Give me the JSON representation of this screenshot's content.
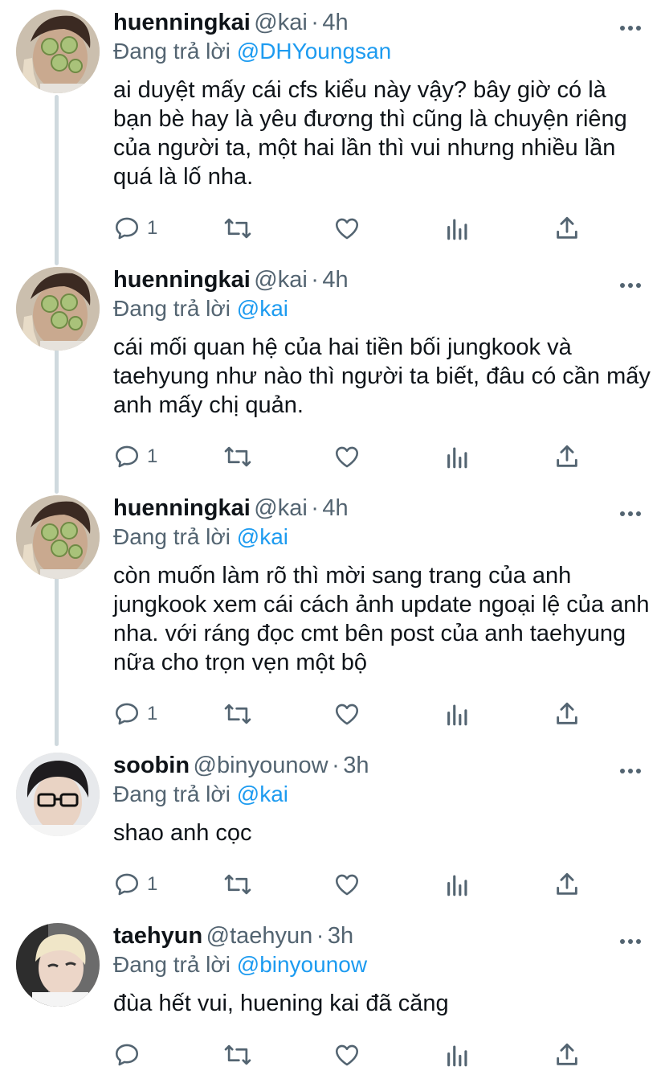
{
  "tweets": [
    {
      "name": "huenningkai",
      "handle": "@kai",
      "sep": "·",
      "time": "4h",
      "replying_prefix": "Đang trả lời",
      "replying_to": "@DHYoungsan",
      "text": "ai duyệt mấy cái cfs kiểu này vậy? bây giờ có là bạn bè hay là yêu đương thì cũng là chuyện riêng của người ta, một hai lần thì vui nhưng nhiều lần quá là lố nha.",
      "reply_count": "1"
    },
    {
      "name": "huenningkai",
      "handle": "@kai",
      "sep": "·",
      "time": "4h",
      "replying_prefix": "Đang trả lời",
      "replying_to": "@kai",
      "text": "cái mối quan hệ của hai tiền bối jungkook và taehyung như nào thì người ta biết, đâu có cần mấy anh mấy chị quản.",
      "reply_count": "1"
    },
    {
      "name": "huenningkai",
      "handle": "@kai",
      "sep": "·",
      "time": "4h",
      "replying_prefix": "Đang trả lời",
      "replying_to": "@kai",
      "text": "còn muốn làm rõ thì mời sang trang của anh jungkook xem cái cách ảnh update ngoại lệ của anh nha. với ráng đọc cmt bên post của anh taehyung nữa cho trọn vẹn một bộ",
      "reply_count": "1"
    },
    {
      "name": "soobin",
      "handle": "@binyounow",
      "sep": "·",
      "time": "3h",
      "replying_prefix": "Đang trả lời",
      "replying_to": "@kai",
      "text": "shao anh cọc",
      "reply_count": "1"
    },
    {
      "name": "taehyun",
      "handle": "@taehyun",
      "sep": "·",
      "time": "3h",
      "replying_prefix": "Đang trả lời",
      "replying_to": "@binyounow",
      "text": "đùa hết vui, huening kai đã căng",
      "reply_count": ""
    }
  ],
  "icons": {
    "more": "more-icon",
    "reply": "reply-icon",
    "retweet": "retweet-icon",
    "like": "like-icon",
    "analytics": "analytics-icon",
    "share": "share-icon"
  },
  "colors": {
    "text": "#0f1419",
    "secondary": "#536471",
    "link": "#1d9bf0",
    "thread_line": "#cfd9de"
  }
}
